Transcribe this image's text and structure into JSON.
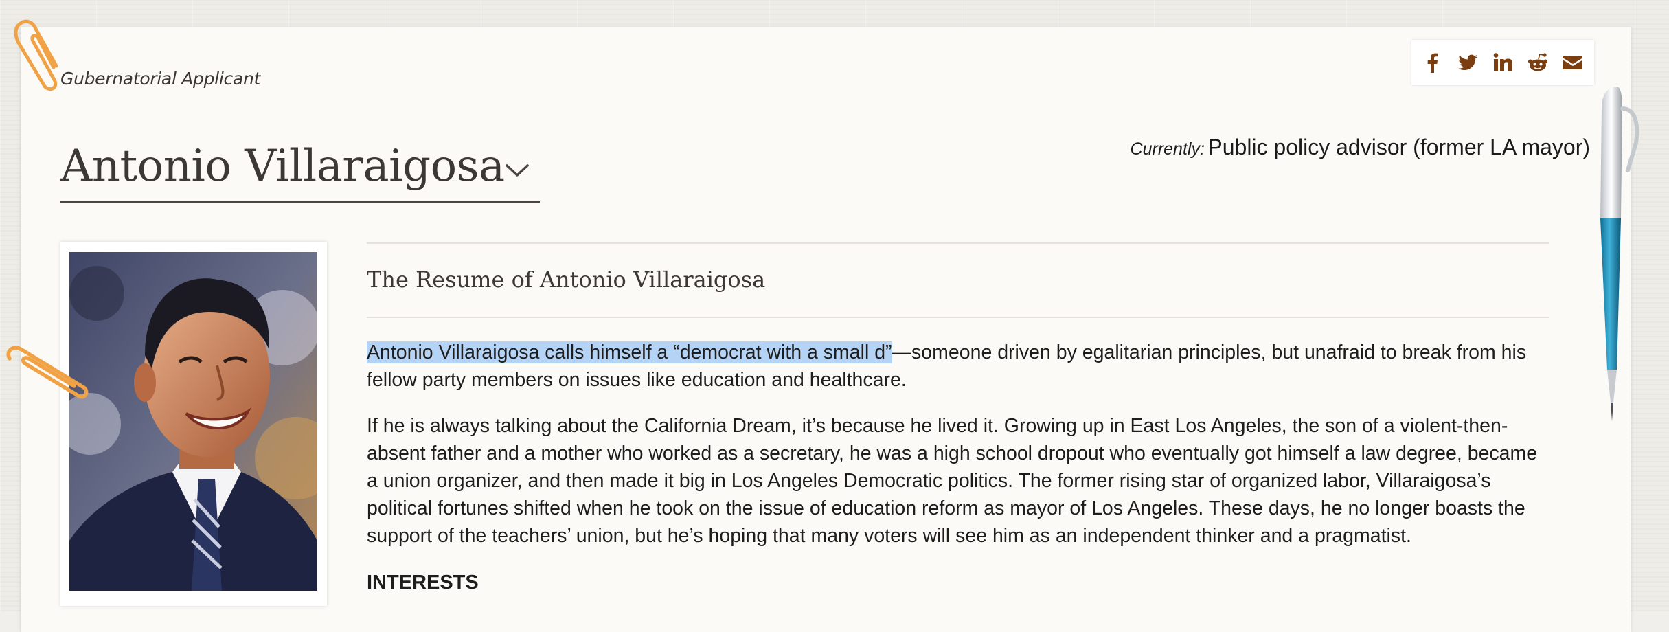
{
  "header": {
    "applicant_label": "Gubernatorial Applicant",
    "currently_label": "Currently:",
    "currently_value": "Public policy advisor (former LA mayor)"
  },
  "share": [
    {
      "name": "facebook-icon"
    },
    {
      "name": "twitter-icon"
    },
    {
      "name": "linkedin-icon"
    },
    {
      "name": "reddit-icon"
    },
    {
      "name": "email-icon"
    }
  ],
  "candidate": {
    "name": "Antonio Villaraigosa"
  },
  "resume": {
    "title": "The Resume of Antonio Villaraigosa",
    "p1_highlight": "Antonio Villaraigosa calls himself a “democrat with a small d”",
    "p1_rest": "—someone driven by egalitarian principles, but unafraid to break from his fellow party members on issues like education and healthcare.",
    "p2": "If he is always talking about the California Dream, it’s because he lived it. Growing up in East Los Angeles, the son of a violent-then-absent father and a mother who worked as a secretary, he was a high school dropout who eventually got himself a law degree, became a union organizer, and then made it big in Los Angeles Democratic politics. The former rising star of organized labor, Villaraigosa’s political fortunes shifted when he took on the issue of education reform as mayor of Los Angeles. These days, he no longer boasts the support of the teachers’ union, but he’s hoping that many voters will see him as an independent thinker and a pragmatist.",
    "interests_heading": "INTERESTS"
  },
  "colors": {
    "accent": "#7a3e10",
    "highlight": "#b5d3f5",
    "paper": "#fcfaf7"
  }
}
